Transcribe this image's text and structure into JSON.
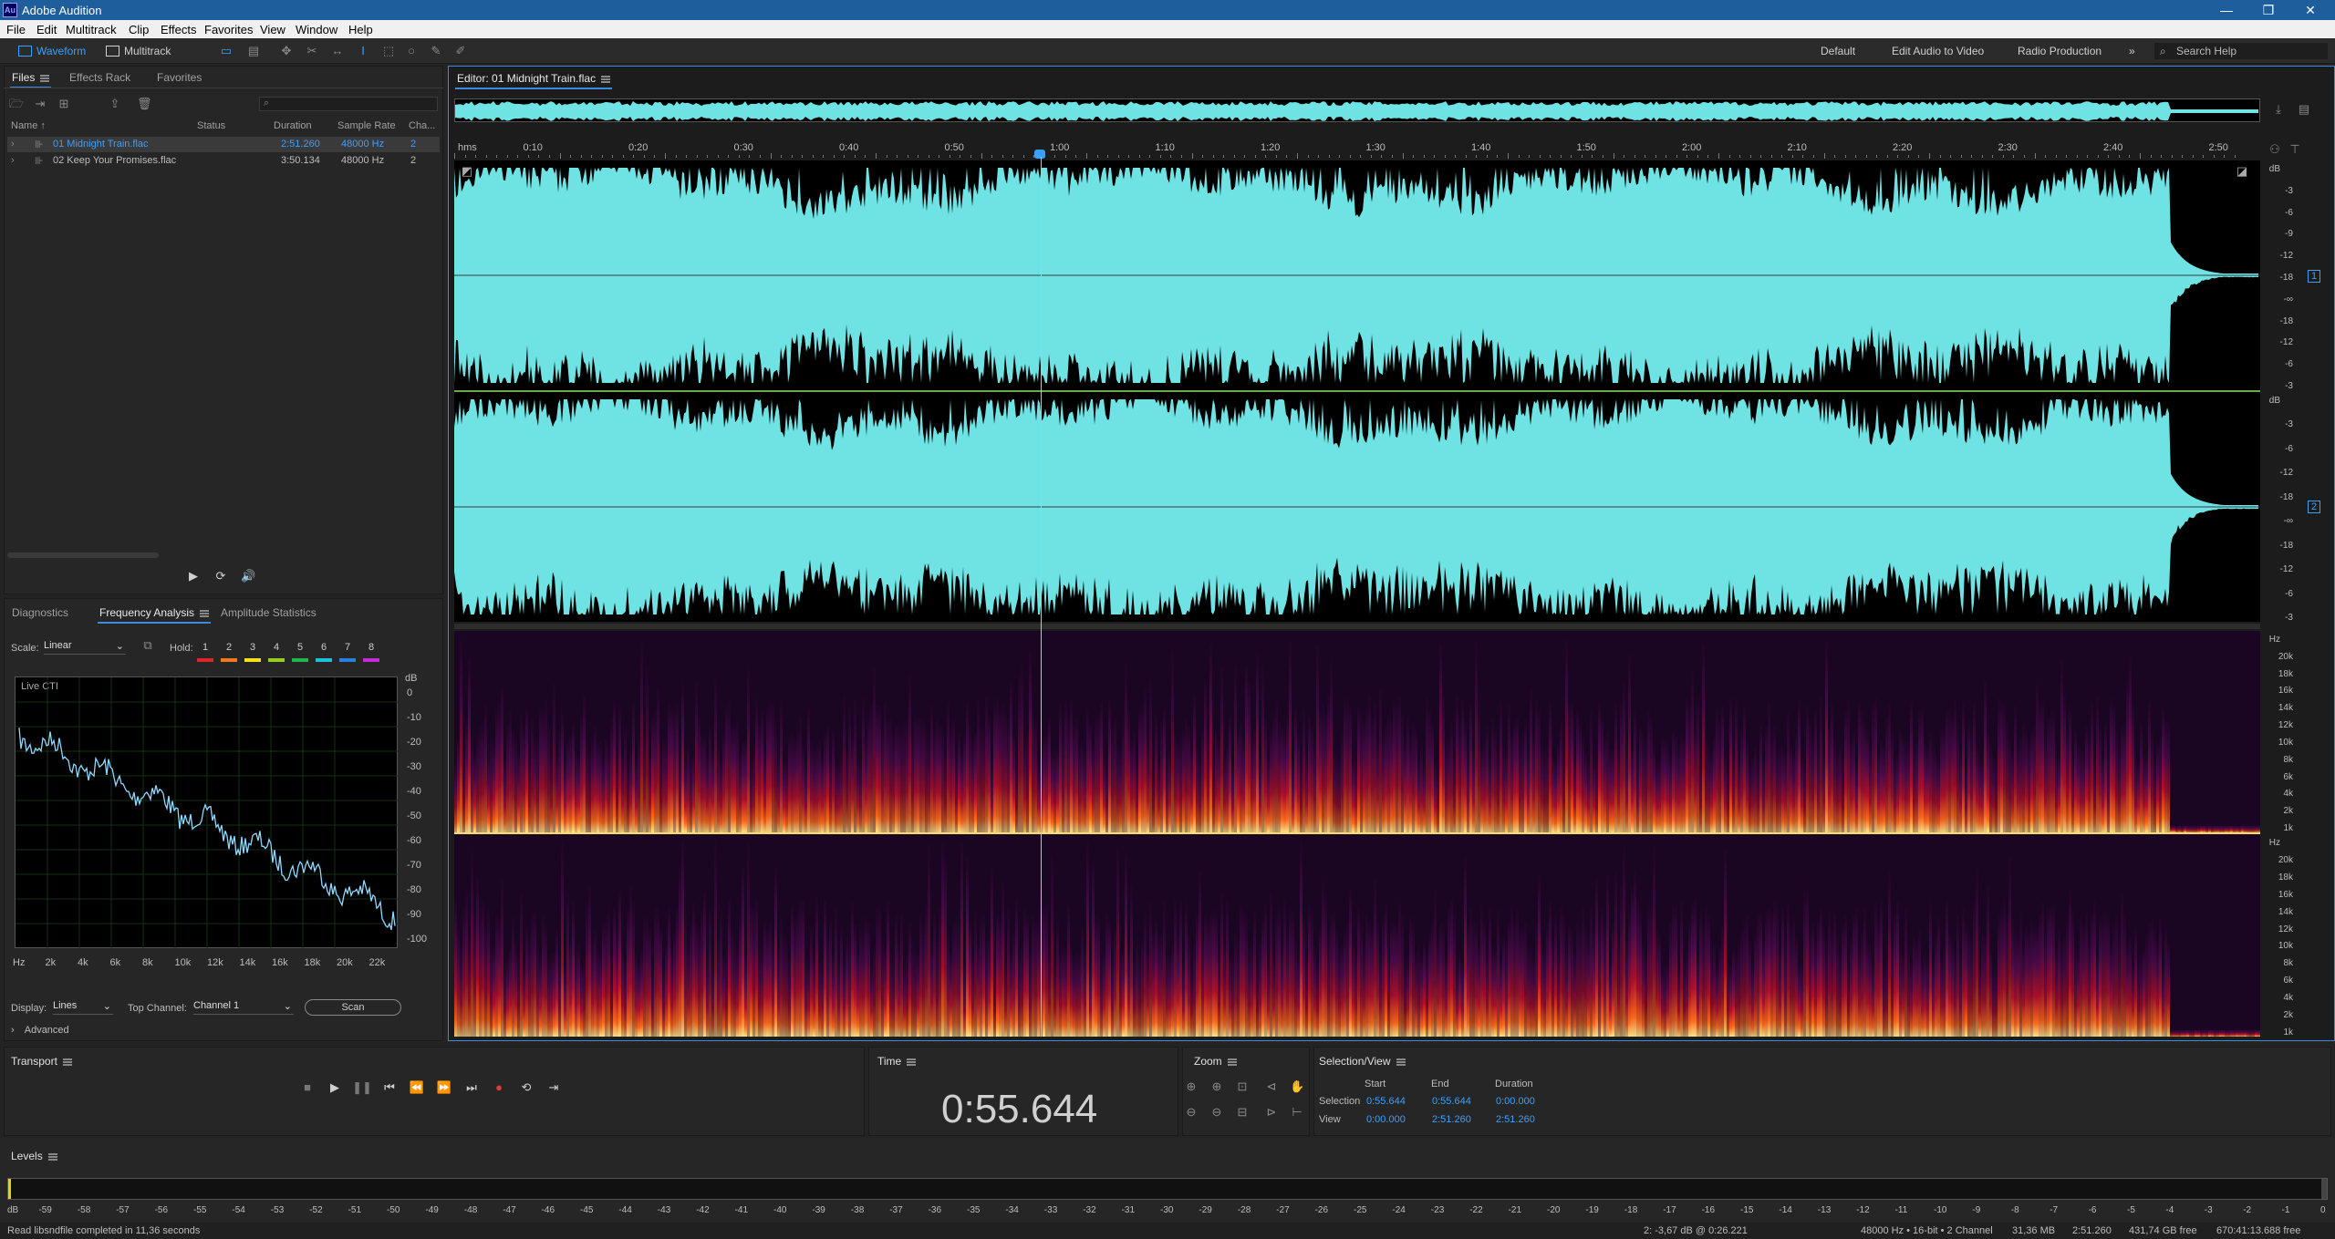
{
  "app": {
    "title": "Adobe Audition",
    "icon_text": "Au",
    "menu": [
      "File",
      "Edit",
      "Multitrack",
      "Clip",
      "Effects",
      "Favorites",
      "View",
      "Window",
      "Help"
    ]
  },
  "toolbar": {
    "modes": [
      {
        "label": "Waveform",
        "active": true
      },
      {
        "label": "Multitrack",
        "active": false
      }
    ],
    "workspaces": [
      "Default",
      "Edit Audio to Video",
      "Radio Production"
    ],
    "more": "»",
    "search_placeholder": "Search Help"
  },
  "files_panel": {
    "tabs": [
      "Files",
      "Effects Rack",
      "Favorites"
    ],
    "columns": [
      "Name ↑",
      "Status",
      "Duration",
      "Sample Rate",
      "Cha..."
    ],
    "rows": [
      {
        "name": "01 Midnight Train.flac",
        "status": "",
        "duration": "2:51.260",
        "rate": "48000 Hz",
        "channels": "2",
        "selected": true
      },
      {
        "name": "02 Keep Your Promises.flac",
        "status": "",
        "duration": "3:50.134",
        "rate": "48000 Hz",
        "channels": "2",
        "selected": false
      }
    ]
  },
  "analysis_panel": {
    "tabs": [
      "Diagnostics",
      "Frequency Analysis",
      "Amplitude Statistics"
    ],
    "scale_label": "Scale:",
    "scale_value": "Linear",
    "hold_label": "Hold:",
    "hold_numbers": [
      "1",
      "2",
      "3",
      "4",
      "5",
      "6",
      "7",
      "8"
    ],
    "hold_colors": [
      "#e0242a",
      "#f07a1d",
      "#f4e31a",
      "#8fd11e",
      "#1fb94a",
      "#1fbfd6",
      "#2a7fe0",
      "#c42ad8"
    ],
    "plot_label": "Live CTI",
    "db_label": "dB",
    "db_ticks": [
      "0",
      "-10",
      "-20",
      "-30",
      "-40",
      "-50",
      "-60",
      "-70",
      "-80",
      "-90",
      "-100"
    ],
    "hz_ticks": [
      "Hz",
      "2k",
      "4k",
      "6k",
      "8k",
      "10k",
      "12k",
      "14k",
      "16k",
      "18k",
      "20k",
      "22k"
    ],
    "display_label": "Display:",
    "display_value": "Lines",
    "top_channel_label": "Top Channel:",
    "top_channel_value": "Channel 1",
    "scan_label": "Scan",
    "advanced_label": "Advanced"
  },
  "editor": {
    "title": "Editor: 01 Midnight Train.flac",
    "ruler": [
      "hms",
      "0:10",
      "0:20",
      "0:30",
      "0:40",
      "0:50",
      "1:00",
      "1:10",
      "1:20",
      "1:30",
      "1:40",
      "1:50",
      "2:00",
      "2:10",
      "2:20",
      "2:30",
      "2:40",
      "2:50"
    ],
    "db_scale": [
      "dB",
      "-3",
      "-6",
      "-9",
      "-12",
      "-18",
      "-∞",
      "-18",
      "-12",
      "-6",
      "-3"
    ],
    "db_scale_ch2": [
      "dB",
      "-3",
      "-6",
      "-12",
      "-18",
      "-∞",
      "-18",
      "-12",
      "-6",
      "-3"
    ],
    "channel_labels": [
      "1",
      "2"
    ],
    "hz_scale": [
      "Hz",
      "20k",
      "18k",
      "16k",
      "14k",
      "12k",
      "10k",
      "8k",
      "6k",
      "4k",
      "2k",
      "1k"
    ],
    "waveform_color": "#6fe3e3",
    "playhead_color": "#e2d900"
  },
  "transport": {
    "title": "Transport",
    "buttons": [
      "stop-icon",
      "play-icon",
      "pause-icon",
      "goto-start-icon",
      "rewind-icon",
      "fast-forward-icon",
      "goto-end-icon",
      "record-icon",
      "loop-icon",
      "skip-selection-icon"
    ]
  },
  "time_panel": {
    "title": "Time",
    "value": "0:55.644"
  },
  "zoom_panel": {
    "title": "Zoom"
  },
  "selection_view": {
    "title": "Selection/View",
    "headers": [
      "Start",
      "End",
      "Duration"
    ],
    "rows": [
      {
        "label": "Selection",
        "start": "0:55.644",
        "end": "0:55.644",
        "duration": "0:00.000"
      },
      {
        "label": "View",
        "start": "0:00.000",
        "end": "2:51.260",
        "duration": "2:51.260"
      }
    ]
  },
  "levels": {
    "title": "Levels",
    "ticks": [
      "dB",
      "-59",
      "-58",
      "-57",
      "-56",
      "-55",
      "-54",
      "-53",
      "-52",
      "-51",
      "-50",
      "-49",
      "-48",
      "-47",
      "-46",
      "-45",
      "-44",
      "-43",
      "-42",
      "-41",
      "-40",
      "-39",
      "-38",
      "-37",
      "-36",
      "-35",
      "-34",
      "-33",
      "-32",
      "-31",
      "-30",
      "-29",
      "-28",
      "-27",
      "-26",
      "-25",
      "-24",
      "-23",
      "-22",
      "-21",
      "-20",
      "-19",
      "-18",
      "-17",
      "-16",
      "-15",
      "-14",
      "-13",
      "-12",
      "-11",
      "-10",
      "-9",
      "-8",
      "-7",
      "-6",
      "-5",
      "-4",
      "-3",
      "-2",
      "-1",
      "0"
    ]
  },
  "status": {
    "left": "Read libsndfile completed in 11,36 seconds",
    "cursor": "2: -3,67 dB @ 0:26.221",
    "format": "48000 Hz • 16-bit • 2 Channel",
    "size": "31,36 MB",
    "duration": "2:51.260",
    "free": "431,74 GB free",
    "time_free": "670:41:13.688 free"
  }
}
